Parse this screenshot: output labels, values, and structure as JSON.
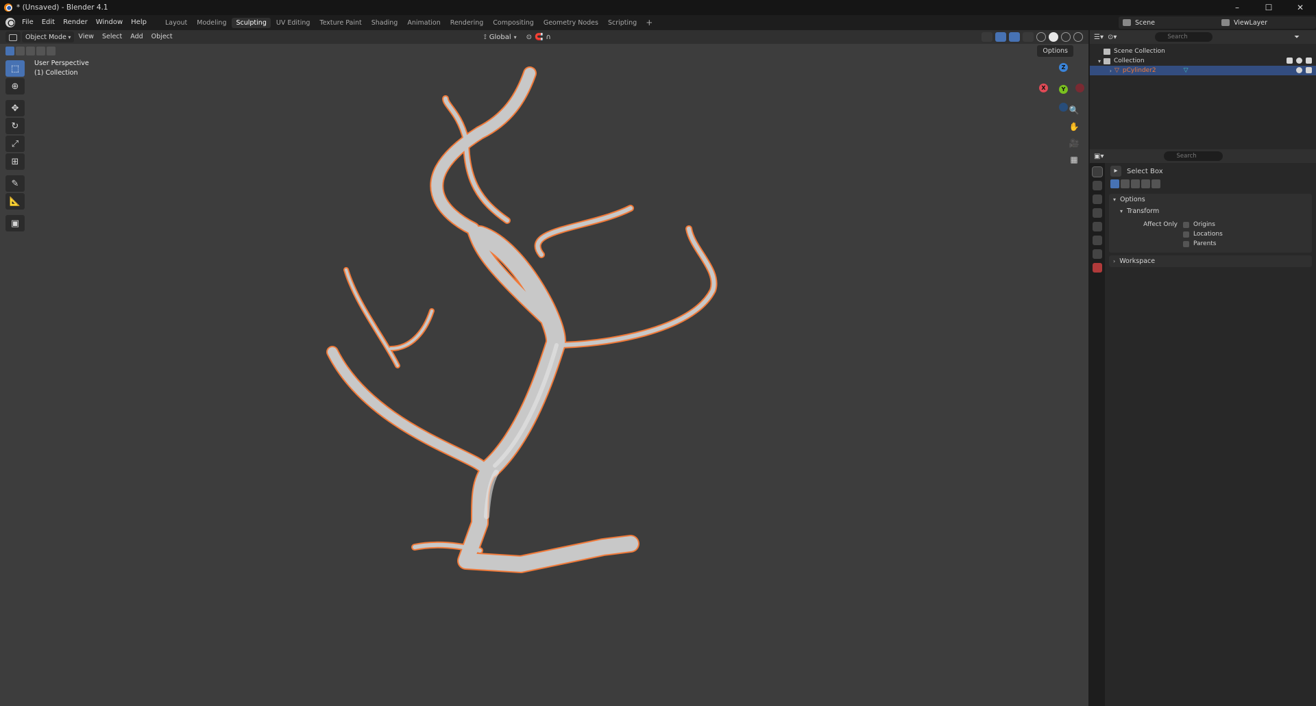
{
  "window": {
    "title": "* (Unsaved) - Blender 4.1",
    "controls": [
      "–",
      "☐",
      "✕"
    ]
  },
  "menu": {
    "items": [
      "File",
      "Edit",
      "Render",
      "Window",
      "Help"
    ]
  },
  "workspaces": {
    "tabs": [
      "Layout",
      "Modeling",
      "Sculpting",
      "UV Editing",
      "Texture Paint",
      "Shading",
      "Animation",
      "Rendering",
      "Compositing",
      "Geometry Nodes",
      "Scripting"
    ],
    "active": "Sculpting",
    "add": "+"
  },
  "scene": {
    "name": "Scene"
  },
  "view_layer": {
    "name": "ViewLayer"
  },
  "viewport": {
    "mode": "Object Mode",
    "menus": [
      "View",
      "Select",
      "Add",
      "Object"
    ],
    "orientation": "Global",
    "options_label": "Options",
    "overlay_title": "User Perspective",
    "overlay_collection": "(1) Collection",
    "gizmo_labels": {
      "x": "X",
      "y": "Y",
      "z": "Z"
    },
    "tools": [
      "select-box-icon",
      "cursor-icon",
      "move-icon",
      "rotate-icon",
      "scale-icon",
      "transform-icon",
      "annotate-icon",
      "measure-icon",
      "add-cube-icon"
    ],
    "accent_color": "#4772b3",
    "selection_outline_color": "#f07a3a"
  },
  "outliner": {
    "search_placeholder": "Search",
    "rows": [
      {
        "label": "Scene Collection"
      },
      {
        "label": "Collection"
      },
      {
        "label": "pCylinder2",
        "selected": true
      }
    ],
    "object_color": "#f07a3a"
  },
  "properties": {
    "search_placeholder": "Search",
    "tool_name": "Select Box",
    "panels": {
      "options": "Options",
      "transform": "Transform",
      "affect_only": "Affect Only",
      "checkboxes": [
        "Origins",
        "Locations",
        "Parents"
      ],
      "workspace": "Workspace"
    }
  }
}
